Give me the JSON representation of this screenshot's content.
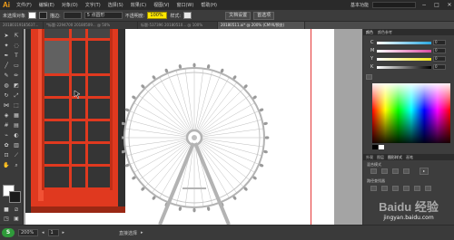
{
  "app": {
    "logo": "Ai",
    "menus": [
      "文件(F)",
      "编辑(E)",
      "对象(O)",
      "文字(T)",
      "选择(S)",
      "效果(C)",
      "视图(V)",
      "窗口(W)",
      "帮助(H)"
    ],
    "workspace": "基本功能",
    "window_controls": [
      "−",
      "□",
      "✕"
    ]
  },
  "control_bar": {
    "selection_label": "未选择对象",
    "stroke_label": "描边:",
    "stroke_profile": "5 点圆形",
    "opacity_label": "不透明度:",
    "opacity_value": "100%",
    "style_label": "样式:",
    "doc_setup_button": "文档设置",
    "preferences_button": "首选项"
  },
  "tabs": [
    {
      "label": "20180319185637...",
      "active": false
    },
    {
      "label": "*标题-2294700 20180509... @ 50%",
      "active": false
    },
    {
      "label": "标题-537396 20180510... @ 100%",
      "active": false
    },
    {
      "label": "20180511.ai* @ 200% (CMYK/预览)",
      "active": true
    }
  ],
  "tools_panel": {
    "fill_color": "#ffffff",
    "stroke_color": "#1b1b1b"
  },
  "color_panel": {
    "tabs": [
      "颜色",
      "颜色参考"
    ],
    "channels": [
      {
        "label": "C",
        "value": "0",
        "color": "#2aa7e0"
      },
      {
        "label": "M",
        "value": "0",
        "color": "#d94aa0"
      },
      {
        "label": "Y",
        "value": "0",
        "color": "#f2e51d"
      },
      {
        "label": "K",
        "value": "0",
        "color": "#666666"
      }
    ]
  },
  "appearance_panel": {
    "tabs": [
      "外观",
      "图层",
      "图形样式",
      "画笔"
    ],
    "blend_label": "混合模式",
    "path_label": "路径查找器"
  },
  "status_bar": {
    "zoom": "200%",
    "page": "1",
    "tool_name": "直接选择"
  },
  "watermark": {
    "brand": "Baidu 经验",
    "url": "jingyan.baidu.com"
  }
}
